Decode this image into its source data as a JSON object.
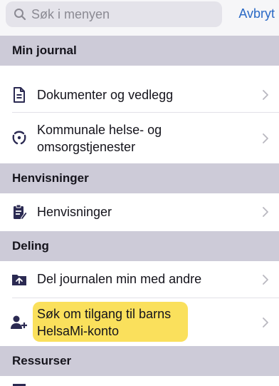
{
  "search": {
    "placeholder": "Søk i menyen",
    "cancel_label": "Avbryt"
  },
  "sections": [
    {
      "title": "Min journal",
      "items": [
        {
          "label": "Dokumenter og vedlegg",
          "icon": "document-icon"
        },
        {
          "label": "Kommunale helse- og omsorgstjenester",
          "label_line1": "Kommunale helse- og",
          "label_line2": "omsorgstjenester",
          "icon": "heart-hands-icon"
        }
      ]
    },
    {
      "title": "Henvisninger",
      "items": [
        {
          "label": "Henvisninger",
          "icon": "clipboard-icon"
        }
      ]
    },
    {
      "title": "Deling",
      "items": [
        {
          "label": "Del journalen min med andre",
          "icon": "folder-share-icon"
        },
        {
          "label": "Søk om tilgang til barns HelsaMi-konto",
          "label_line1": "Søk om tilgang til barns",
          "label_line2": "HelsaMi-konto",
          "icon": "add-person-icon",
          "highlighted": true
        }
      ]
    },
    {
      "title": "Ressurser",
      "items": []
    }
  ],
  "colors": {
    "accent": "#2a69c5",
    "header_bg": "#cdcbd8",
    "icon": "#2b2a52",
    "highlight": "#f9dd4a"
  }
}
